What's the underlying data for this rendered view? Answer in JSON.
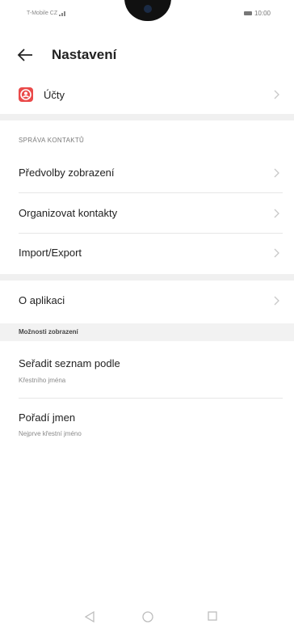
{
  "status_bar": {
    "carrier": "T-Mobile CZ",
    "time": "10:00"
  },
  "header": {
    "title": "Nastavení"
  },
  "accounts": {
    "label": "Účty"
  },
  "contacts_section": {
    "heading": "SPRÁVA KONTAKTŮ",
    "items": [
      {
        "label": "Předvolby zobrazení"
      },
      {
        "label": "Organizovat kontakty"
      },
      {
        "label": "Import/Export"
      }
    ]
  },
  "about": {
    "label": "O aplikaci"
  },
  "display_options": {
    "heading": "Možnosti zobrazení",
    "sort": {
      "label": "Seřadit seznam podle",
      "value": "Křestního jména"
    },
    "name_order": {
      "label": "Pořadí jmen",
      "value": "Nejprve křestní jméno"
    }
  },
  "icons": {
    "back": "arrow-left-icon",
    "accounts": "account-icon",
    "chevron": "chevron-right-icon",
    "nav_back": "triangle-back-icon",
    "nav_home": "circle-home-icon",
    "nav_recent": "square-recent-icon"
  },
  "colors": {
    "accent": "#ea4a4a",
    "divider": "#e6e6e6",
    "section_bg": "#f0f0f0"
  }
}
